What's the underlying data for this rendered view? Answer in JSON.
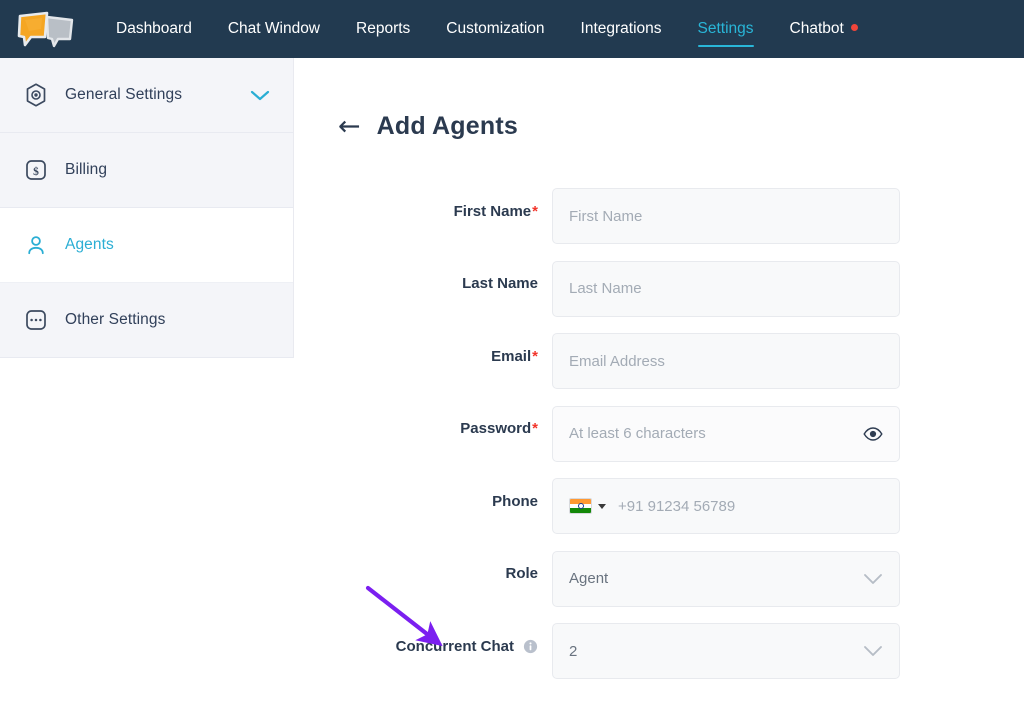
{
  "navbar": {
    "logo_name": "chat-bubbles-logo",
    "background": "#223a50",
    "accent": "#29b6d8",
    "badge_color": "#f0453a",
    "links": [
      {
        "label": "Dashboard",
        "active": false,
        "badge": false
      },
      {
        "label": "Chat Window",
        "active": false,
        "badge": false
      },
      {
        "label": "Reports",
        "active": false,
        "badge": false
      },
      {
        "label": "Customization",
        "active": false,
        "badge": false
      },
      {
        "label": "Integrations",
        "active": false,
        "badge": false
      },
      {
        "label": "Settings",
        "active": true,
        "badge": false
      },
      {
        "label": "Chatbot",
        "active": false,
        "badge": true
      }
    ]
  },
  "sidebar": {
    "items": [
      {
        "label": "General Settings",
        "icon": "hexagon-settings-icon",
        "active": false,
        "chevron": "chevron-down-icon"
      },
      {
        "label": "Billing",
        "icon": "dollar-square-icon",
        "active": false,
        "chevron": ""
      },
      {
        "label": "Agents",
        "icon": "user-icon",
        "active": true,
        "chevron": ""
      },
      {
        "label": "Other Settings",
        "icon": "dots-square-icon",
        "active": false,
        "chevron": ""
      }
    ],
    "active_color": "#2aaed4"
  },
  "page": {
    "back_label": "←",
    "title": "Add Agents"
  },
  "form": {
    "fields": [
      {
        "label": "First Name",
        "required": true,
        "type": "text",
        "placeholder": "First Name",
        "value": "",
        "info": false
      },
      {
        "label": "Last Name",
        "required": false,
        "type": "text",
        "placeholder": "Last Name",
        "value": "",
        "info": false
      },
      {
        "label": "Email",
        "required": true,
        "type": "text",
        "placeholder": "Email Address",
        "value": "",
        "info": false
      },
      {
        "label": "Password",
        "required": true,
        "type": "password",
        "placeholder": "At least 6 characters",
        "value": "",
        "trailing_icon": "eye-icon",
        "info": false
      },
      {
        "label": "Phone",
        "required": false,
        "type": "phone",
        "placeholder": "+91 91234 56789",
        "value": "",
        "country_flag": "india-flag-icon",
        "info": false
      },
      {
        "label": "Role",
        "required": false,
        "type": "select",
        "placeholder": "",
        "value": "Agent",
        "trailing_icon": "chevron-down-icon",
        "info": false
      },
      {
        "label": "Concurrent Chat",
        "required": false,
        "type": "select",
        "placeholder": "",
        "value": "2",
        "trailing_icon": "chevron-down-icon",
        "info": true,
        "info_icon": "info-circle-icon"
      }
    ],
    "required_marker": "*",
    "required_color": "#f2342a"
  },
  "annotation": {
    "type": "arrow",
    "color": "#7b1ff0",
    "points": "from (368,588) to (440,645)",
    "target": "concurrent-chat-label"
  }
}
